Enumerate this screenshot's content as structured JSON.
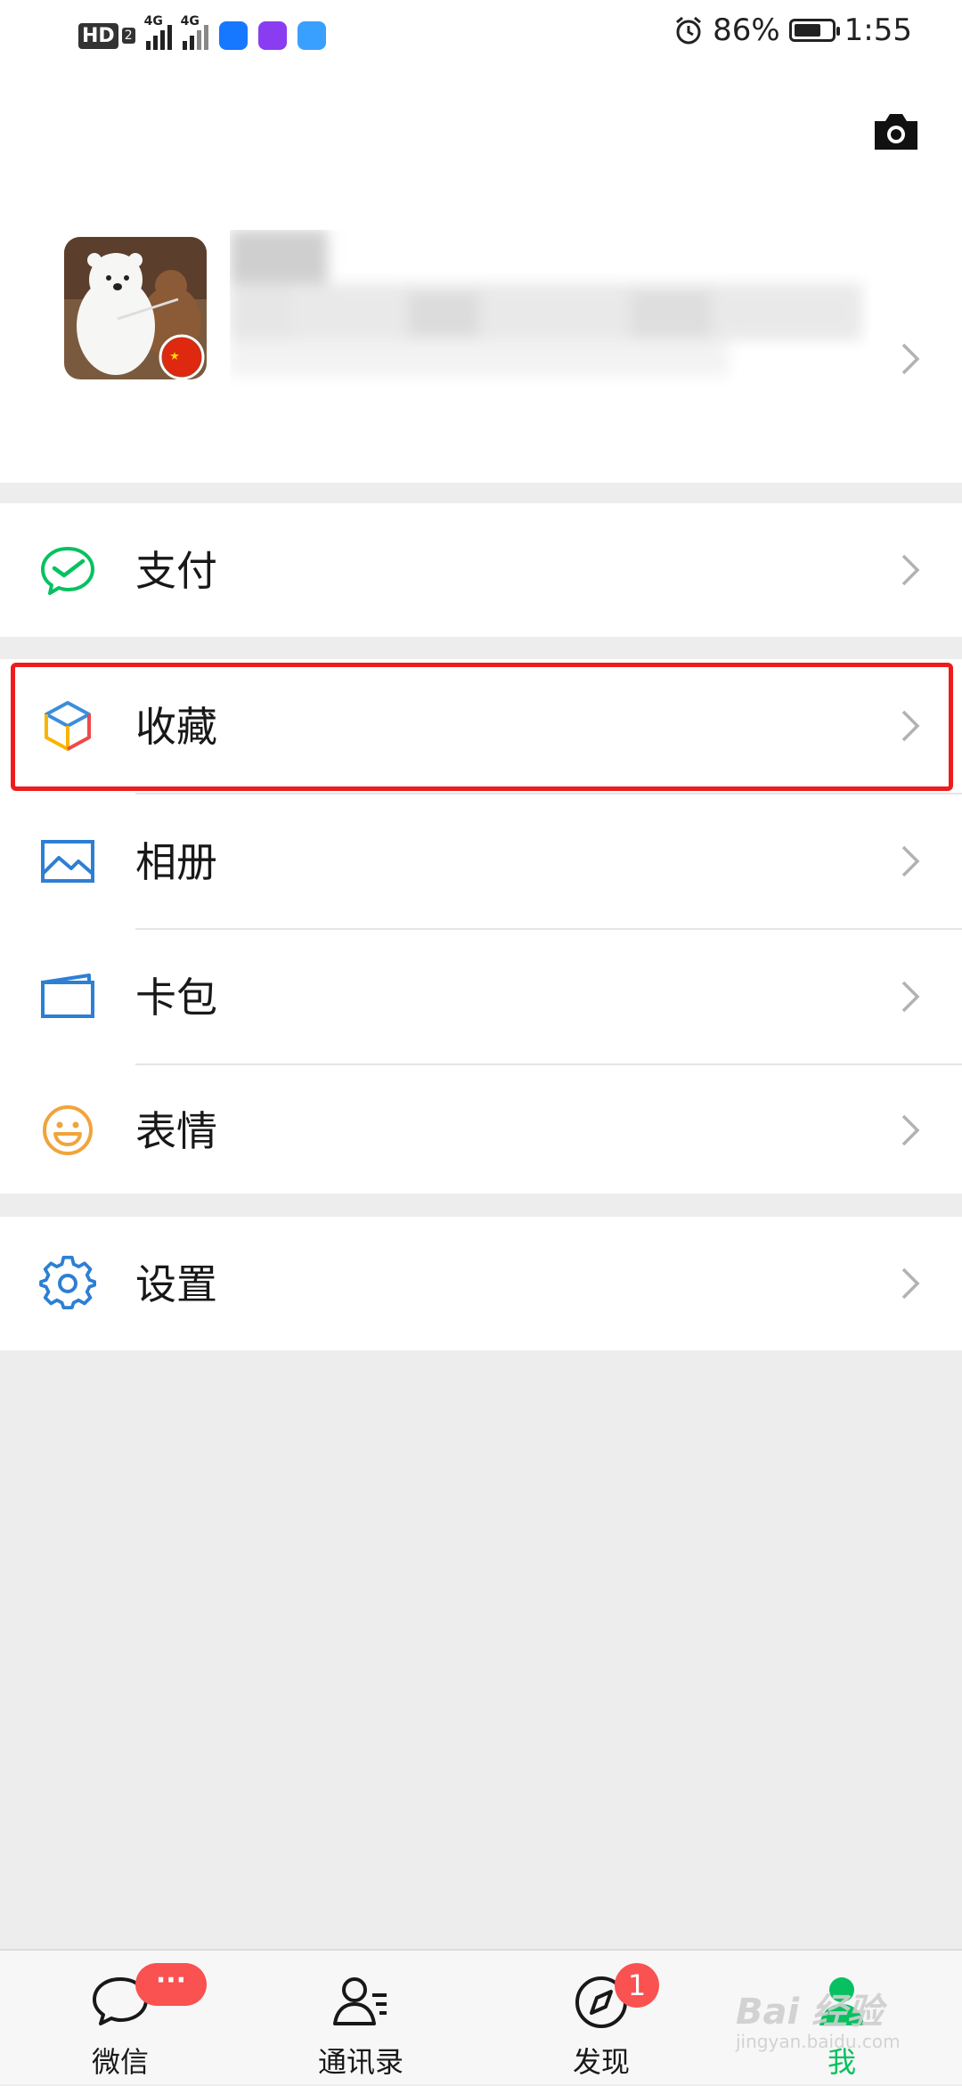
{
  "status_bar": {
    "hd": "HD",
    "hd_sub": "2",
    "sim1": "4G",
    "sim2": "4G",
    "battery_percent": "86%",
    "battery_level": 0.86,
    "time": "1:55"
  },
  "icons": {
    "camera": "camera-icon",
    "pay": "wallet-check-icon",
    "favorites": "cube-icon",
    "album": "picture-icon",
    "cards": "card-wallet-icon",
    "stickers": "smiley-icon",
    "settings": "gear-icon"
  },
  "menu": {
    "pay": "支付",
    "favorites": "收藏",
    "album": "相册",
    "cards": "卡包",
    "stickers": "表情",
    "settings": "设置"
  },
  "tabs": {
    "chats": "微信",
    "contacts": "通讯录",
    "discover": "发现",
    "me": "我",
    "chats_badge": "···",
    "discover_badge": "1"
  },
  "watermark": {
    "main": "Bai 经验",
    "sub": "jingyan.baidu.com"
  },
  "colors": {
    "accent": "#07c160",
    "badge": "#fa5151",
    "highlight": "#ee1c1c"
  }
}
